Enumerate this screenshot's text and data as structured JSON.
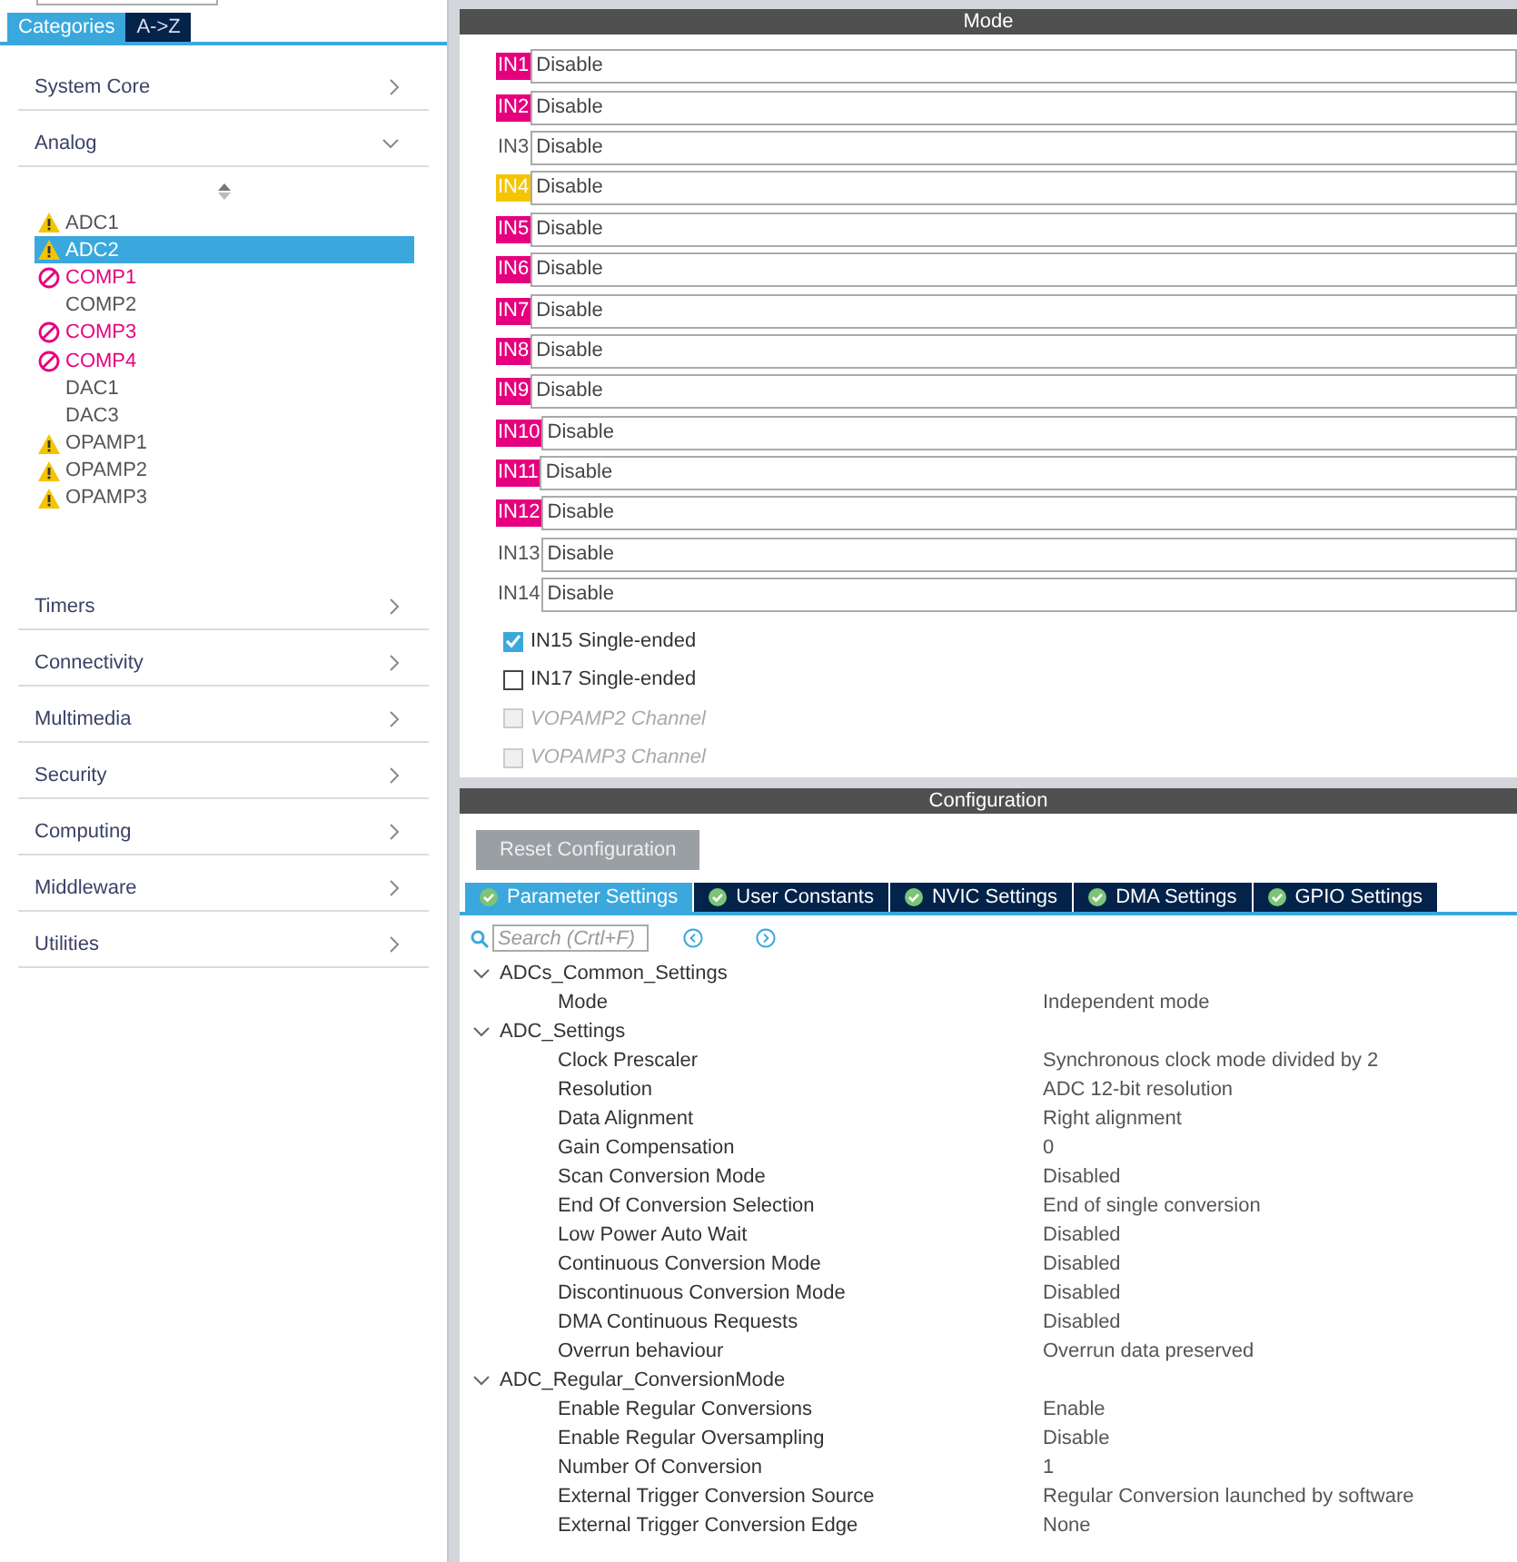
{
  "sidebar": {
    "tabs": [
      {
        "label": "Categories",
        "selected": true
      },
      {
        "label": "A->Z",
        "selected": false
      }
    ],
    "categories": [
      {
        "label": "System Core",
        "expanded": false
      },
      {
        "label": "Analog",
        "expanded": true,
        "items": [
          {
            "label": "ADC1",
            "kind": "warning",
            "selected": false
          },
          {
            "label": "ADC2",
            "kind": "warning",
            "selected": true
          },
          {
            "label": "COMP1",
            "kind": "error",
            "selected": false
          },
          {
            "label": "COMP2",
            "kind": "plain",
            "selected": false
          },
          {
            "label": "COMP3",
            "kind": "error",
            "selected": false
          },
          {
            "label": "COMP4",
            "kind": "error",
            "selected": false
          },
          {
            "label": "DAC1",
            "kind": "plain",
            "selected": false
          },
          {
            "label": "DAC3",
            "kind": "plain",
            "selected": false
          },
          {
            "label": "OPAMP1",
            "kind": "warning",
            "selected": false
          },
          {
            "label": "OPAMP2",
            "kind": "warning",
            "selected": false
          },
          {
            "label": "OPAMP3",
            "kind": "warning",
            "selected": false
          }
        ]
      },
      {
        "label": "Timers",
        "expanded": false
      },
      {
        "label": "Connectivity",
        "expanded": false
      },
      {
        "label": "Multimedia",
        "expanded": false
      },
      {
        "label": "Security",
        "expanded": false
      },
      {
        "label": "Computing",
        "expanded": false
      },
      {
        "label": "Middleware",
        "expanded": false
      },
      {
        "label": "Utilities",
        "expanded": false
      }
    ]
  },
  "mode": {
    "title": "Mode",
    "inputs": [
      {
        "label": "IN1",
        "value": "Disable",
        "color": "#e6007e"
      },
      {
        "label": "IN2",
        "value": "Disable",
        "color": "#e6007e"
      },
      {
        "label": "IN3",
        "value": "Disable"
      },
      {
        "label": "IN4",
        "value": "Disable",
        "color": "#f5c400"
      },
      {
        "label": "IN5",
        "value": "Disable",
        "color": "#e6007e"
      },
      {
        "label": "IN6",
        "value": "Disable",
        "color": "#e6007e"
      },
      {
        "label": "IN7",
        "value": "Disable",
        "color": "#e6007e"
      },
      {
        "label": "IN8",
        "value": "Disable",
        "color": "#e6007e"
      },
      {
        "label": "IN9",
        "value": "Disable",
        "color": "#e6007e"
      },
      {
        "label": "IN10",
        "value": "Disable",
        "color": "#e6007e"
      },
      {
        "label": "IN11",
        "value": "Disable",
        "color": "#e6007e"
      },
      {
        "label": "IN12",
        "value": "Disable",
        "color": "#e6007e"
      },
      {
        "label": "IN13",
        "value": "Disable"
      },
      {
        "label": "IN14",
        "value": "Disable"
      }
    ],
    "checkboxes": [
      {
        "label": "IN15 Single-ended",
        "checked": true,
        "disabled": false
      },
      {
        "label": "IN17 Single-ended",
        "checked": false,
        "disabled": false
      },
      {
        "label": "VOPAMP2 Channel",
        "checked": false,
        "disabled": true
      },
      {
        "label": "VOPAMP3 Channel",
        "checked": false,
        "disabled": true
      }
    ]
  },
  "configuration": {
    "title": "Configuration",
    "reset_button": "Reset Configuration",
    "tabs": [
      {
        "label": "Parameter Settings",
        "selected": true
      },
      {
        "label": "User Constants",
        "selected": false
      },
      {
        "label": "NVIC Settings",
        "selected": false
      },
      {
        "label": "DMA Settings",
        "selected": false
      },
      {
        "label": "GPIO Settings",
        "selected": false
      }
    ],
    "search": {
      "placeholder": "Search (Crtl+F)"
    },
    "groups": [
      {
        "label": "ADCs_Common_Settings",
        "expanded": true,
        "params": [
          {
            "name": "Mode",
            "value": "Independent mode"
          }
        ]
      },
      {
        "label": "ADC_Settings",
        "expanded": true,
        "params": [
          {
            "name": "Clock Prescaler",
            "value": "Synchronous clock mode divided by 2"
          },
          {
            "name": "Resolution",
            "value": "ADC 12-bit resolution"
          },
          {
            "name": "Data Alignment",
            "value": "Right alignment"
          },
          {
            "name": "Gain Compensation",
            "value": "0"
          },
          {
            "name": "Scan Conversion Mode",
            "value": "Disabled"
          },
          {
            "name": "End Of Conversion Selection",
            "value": "End of single conversion"
          },
          {
            "name": "Low Power Auto Wait",
            "value": "Disabled"
          },
          {
            "name": "Continuous Conversion Mode",
            "value": "Disabled"
          },
          {
            "name": "Discontinuous Conversion Mode",
            "value": "Disabled"
          },
          {
            "name": "DMA Continuous Requests",
            "value": "Disabled"
          },
          {
            "name": "Overrun behaviour",
            "value": "Overrun data preserved"
          }
        ]
      },
      {
        "label": "ADC_Regular_ConversionMode",
        "expanded": true,
        "params": [
          {
            "name": "Enable Regular Conversions",
            "value": "Enable"
          },
          {
            "name": "Enable Regular Oversampling",
            "value": "Disable"
          },
          {
            "name": "Number Of Conversion",
            "value": "1"
          },
          {
            "name": "External Trigger Conversion Source",
            "value": "Regular Conversion launched by software"
          },
          {
            "name": "External Trigger Conversion Edge",
            "value": "None"
          }
        ]
      }
    ]
  }
}
